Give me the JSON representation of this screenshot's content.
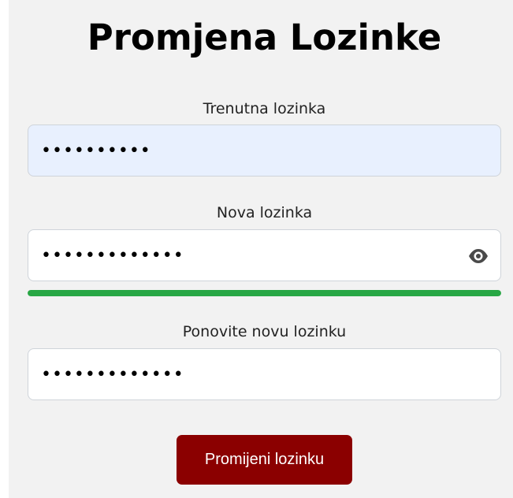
{
  "page": {
    "title": "Promjena Lozinke"
  },
  "form": {
    "current_password": {
      "label": "Trenutna lozinka",
      "value": "••••••••••"
    },
    "new_password": {
      "label": "Nova lozinka",
      "value": "•••••••••••••",
      "toggle_icon": "eye-icon"
    },
    "strength": {
      "fraction": 1.0,
      "color": "#28a745"
    },
    "confirm_password": {
      "label": "Ponovite novu lozinku",
      "value": "•••••••••••••"
    },
    "submit_label": "Promijeni lozinku"
  },
  "colors": {
    "primary_button": "#8b0000",
    "autofill_background": "#e8f0fe",
    "panel_background": "#f2f2f2"
  }
}
